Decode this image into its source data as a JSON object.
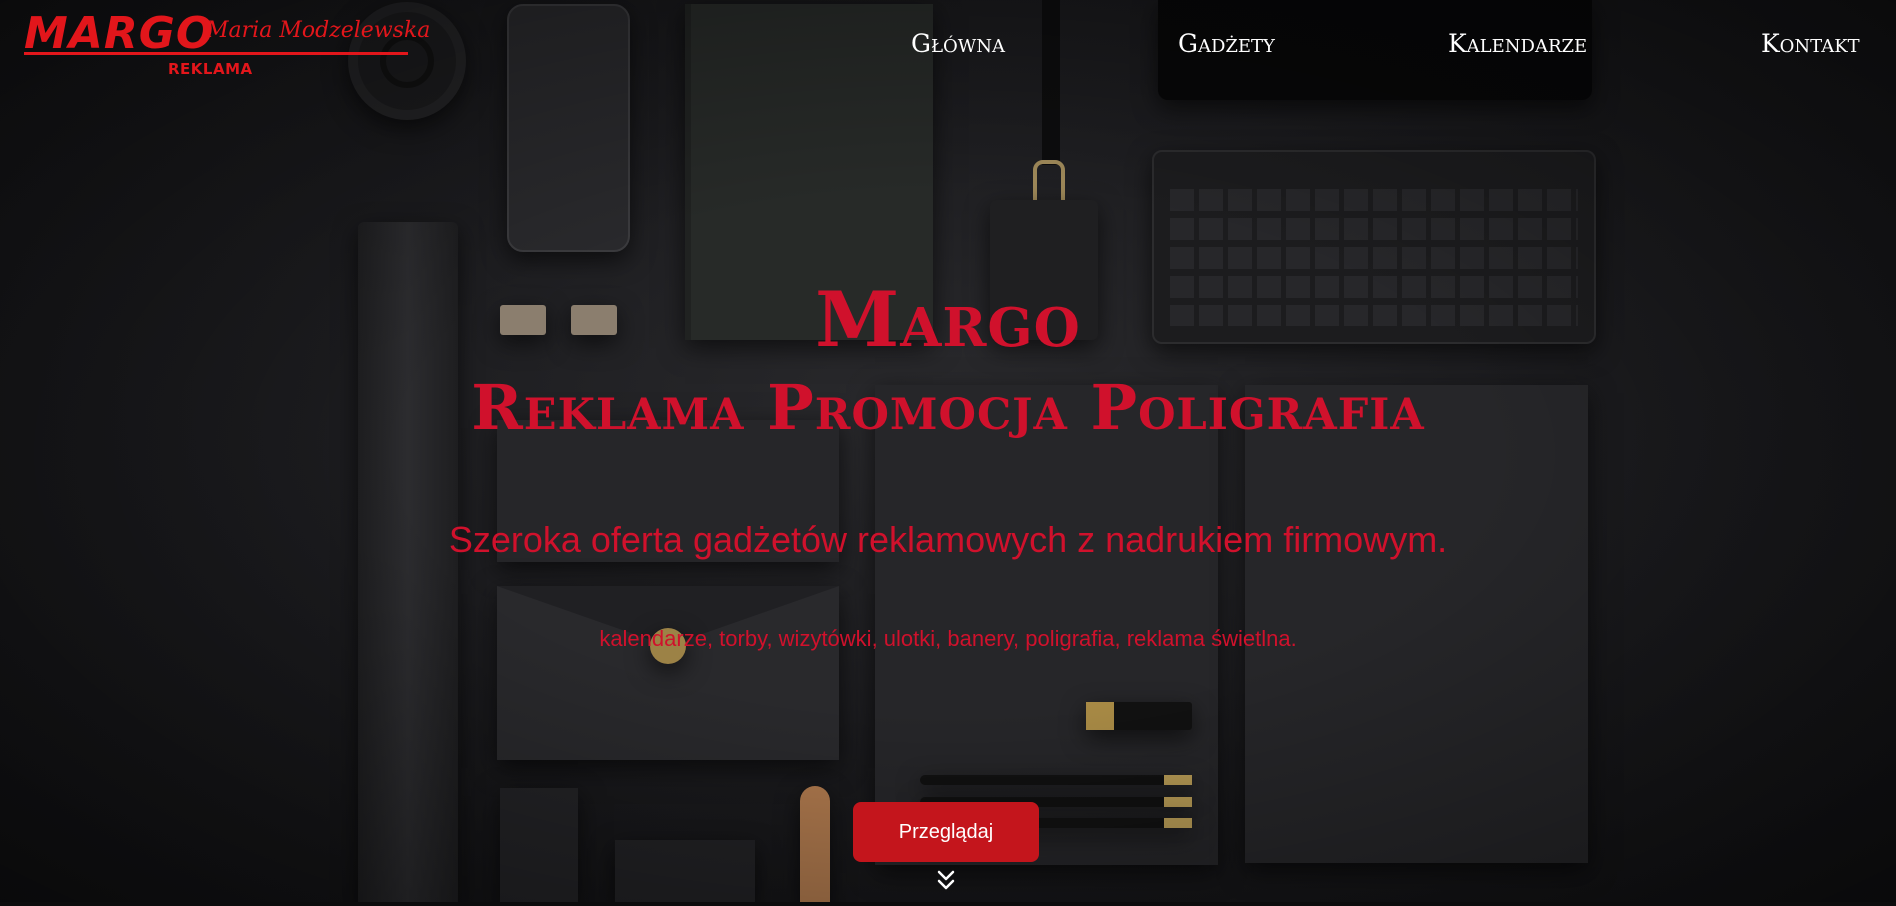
{
  "logo": {
    "brand": "MARGO",
    "owner_name": "Maria Modzelewska",
    "subtitle": "REKLAMA"
  },
  "nav": {
    "items": [
      {
        "label": "Główna"
      },
      {
        "label": "Gadżety"
      },
      {
        "label": "Kalendarze"
      },
      {
        "label": "Kontakt"
      }
    ]
  },
  "hero": {
    "title": "Margo",
    "subtitle": "Reklama Promocja Poligrafia",
    "lead": "Szeroka oferta gadżetów reklamowych z nadrukiem firmowym.",
    "list": "kalendarze, torby, wizytówki, ulotki, banery, poligrafia, reklama świetlna.",
    "cta_label": "Przeglądaj",
    "scroll_icon": "double-chevron-down-icon"
  },
  "colors": {
    "accent": "#d0112c",
    "button": "#c4151c",
    "background": "#1c1c1f",
    "nav_text": "#ffffff"
  }
}
